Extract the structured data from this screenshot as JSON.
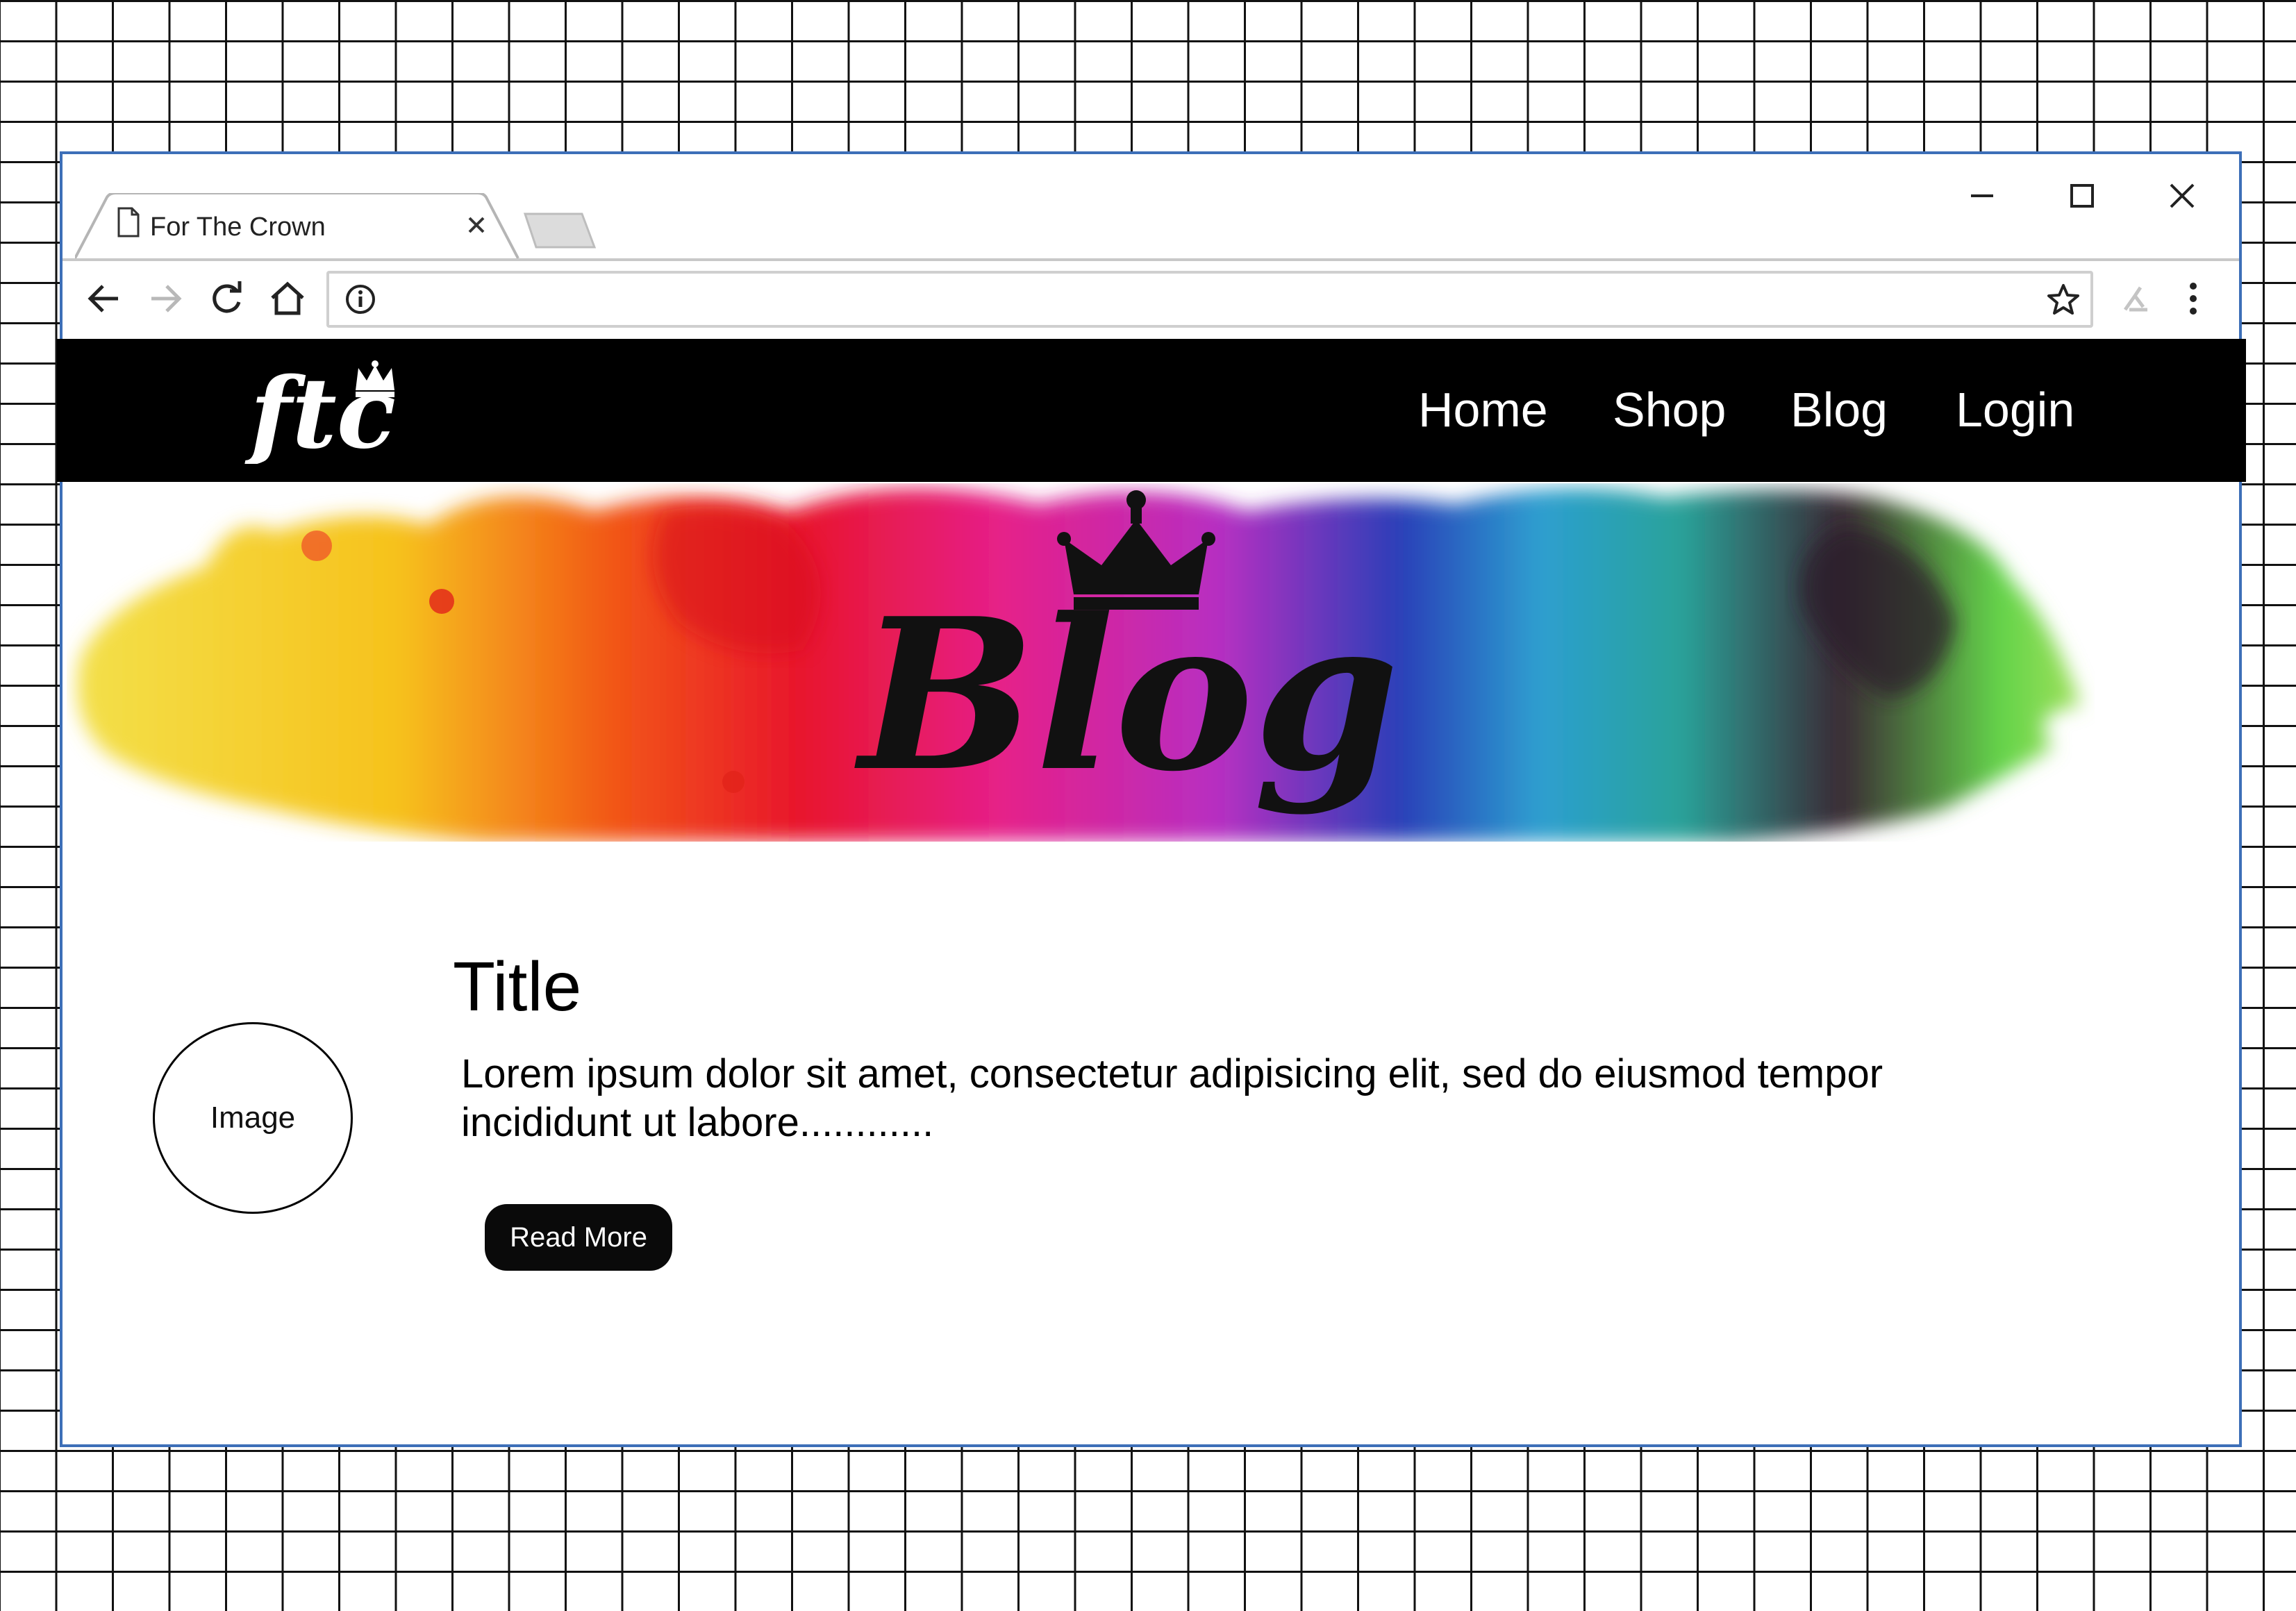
{
  "browser": {
    "tab_title": "For The Crown",
    "address_value": "",
    "icons": [
      "doc-icon",
      "close-icon",
      "back-icon",
      "forward-icon",
      "reload-icon",
      "home-icon",
      "info-icon",
      "star-icon",
      "extension-icon",
      "menu-icon",
      "minimize-icon",
      "maximize-icon",
      "window-close-icon"
    ]
  },
  "site": {
    "logo_text": "ftc",
    "nav": [
      {
        "label": "Home"
      },
      {
        "label": "Shop"
      },
      {
        "label": "Blog"
      },
      {
        "label": "Login"
      }
    ],
    "hero_title": "Blog",
    "post": {
      "image_label": "Image",
      "title": "Title",
      "excerpt": "Lorem ipsum dolor sit amet, consectetur adipisicing elit, sed do eiusmod tempor incididunt ut labore............",
      "button_label": "Read More"
    }
  },
  "colors": {
    "window_border": "#3d6fb8",
    "nav_background": "#000000",
    "button_background": "#0a0a0a",
    "grid_lines": "#111111"
  }
}
